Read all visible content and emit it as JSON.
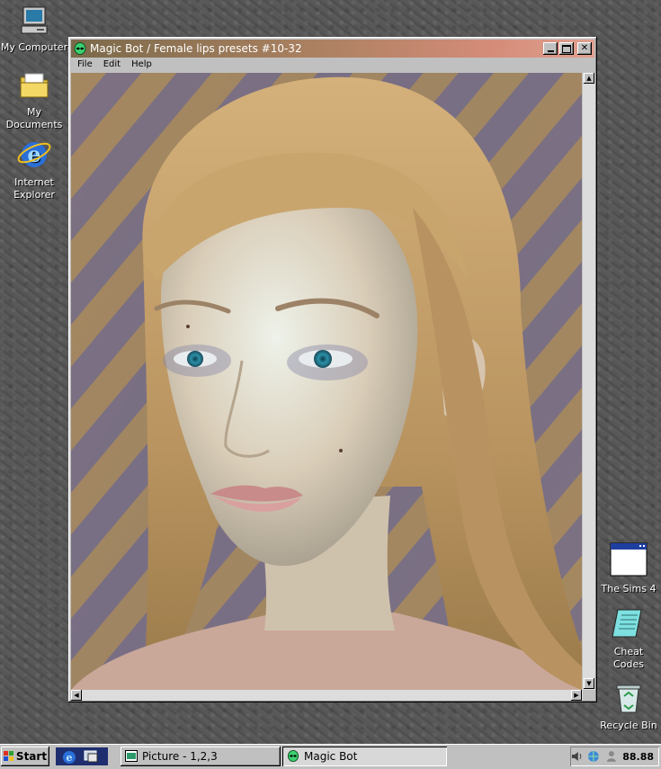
{
  "desktop": {
    "icons_left": [
      {
        "label": "My Computer",
        "icon": "my-computer-icon"
      },
      {
        "label": "My Documents",
        "icon": "folder-icon"
      },
      {
        "label": "Internet Explorer",
        "icon": "internet-explorer-icon"
      }
    ],
    "icons_right": [
      {
        "label": "The Sims 4",
        "icon": "window-icon"
      },
      {
        "label": "Cheat Codes",
        "icon": "notepad-icon"
      },
      {
        "label": "Recycle Bin",
        "icon": "recycle-bin-icon"
      }
    ]
  },
  "window": {
    "title": "Magic Bot / Female lips presets #10-32",
    "title_icon": "alien-icon",
    "buttons": {
      "minimize": "minimize-icon",
      "maximize": "maximize-icon",
      "close": "close-icon"
    },
    "menu": [
      "File",
      "Edit",
      "Help"
    ],
    "content_image": "render of a woman's face with long blonde hair",
    "scroll": {
      "up": "▲",
      "down": "▼",
      "left": "◀",
      "right": "▶"
    }
  },
  "taskbar": {
    "start_label": "Start",
    "quick_launch": [
      "internet-explorer-icon",
      "show-desktop-icon"
    ],
    "tasks": [
      {
        "label": "Picture - 1,2,3",
        "icon": "picture-icon",
        "active": false
      },
      {
        "label": "Magic Bot",
        "icon": "alien-icon",
        "active": true
      }
    ],
    "tray": {
      "icons": [
        "volume-icon",
        "network-icon",
        "user-icon"
      ],
      "clock": "88.88"
    }
  },
  "colors": {
    "accent": "#d48c78",
    "desktop": "#555555",
    "chrome": "#c0c0c0"
  }
}
